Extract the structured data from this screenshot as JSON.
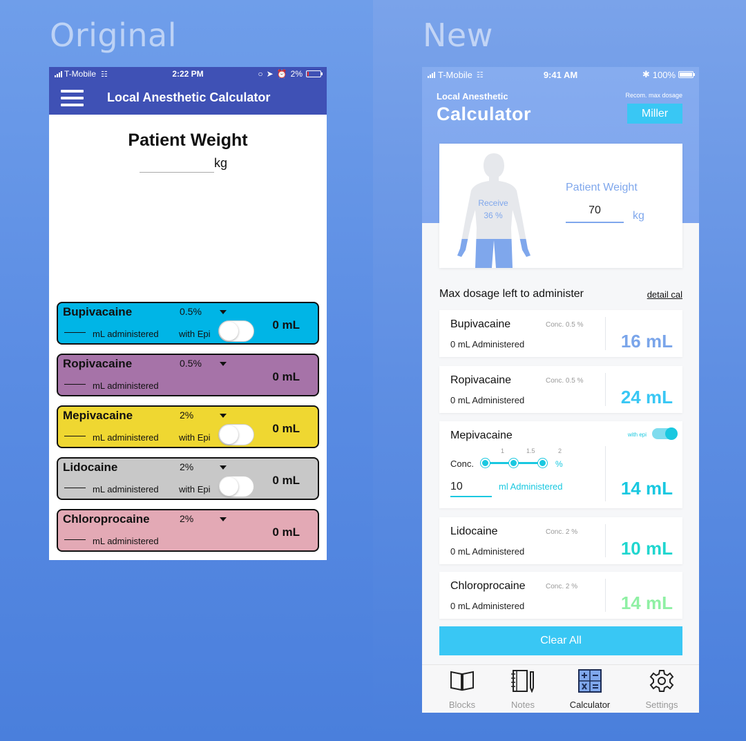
{
  "headings": {
    "original": "Original",
    "new": "New"
  },
  "original": {
    "status": {
      "carrier": "T-Mobile",
      "time": "2:22 PM",
      "battery": "2%"
    },
    "appbar": {
      "title": "Local Anesthetic Calculator"
    },
    "weight": {
      "title": "Patient Weight",
      "unit": "kg"
    },
    "drugs": [
      {
        "name": "Bupivacaine",
        "conc": "0.5%",
        "admin": "mL administered",
        "epi": "with Epi",
        "has_epi": true,
        "total": "0 mL",
        "color": "#00b5e6"
      },
      {
        "name": "Ropivacaine",
        "conc": "0.5%",
        "admin": "mL administered",
        "epi": "",
        "has_epi": false,
        "total": "0 mL",
        "color": "#a673a8"
      },
      {
        "name": "Mepivacaine",
        "conc": "2%",
        "admin": "mL administered",
        "epi": "with Epi",
        "has_epi": true,
        "total": "0 mL",
        "color": "#efd731"
      },
      {
        "name": "Lidocaine",
        "conc": "2%",
        "admin": "mL administered",
        "epi": "with Epi",
        "has_epi": true,
        "total": "0 mL",
        "color": "#c8c8c8"
      },
      {
        "name": "Chloroprocaine",
        "conc": "2%",
        "admin": "mL administered",
        "epi": "",
        "has_epi": false,
        "total": "0 mL",
        "color": "#e3a9b5"
      }
    ]
  },
  "new": {
    "status": {
      "carrier": "T-Mobile",
      "time": "9:41 AM",
      "battery": "100%"
    },
    "header": {
      "subtitle": "Local Anesthetic",
      "title": "Calculator",
      "recom_label": "Recom. max dosage",
      "recom_value": "Miller"
    },
    "weight_card": {
      "receive_label": "Receive",
      "receive_pct": "36 %",
      "label": "Patient Weight",
      "value": "70",
      "unit": "kg"
    },
    "max_label": "Max dosage left to administer",
    "detail_link": "detail cal",
    "cards": [
      {
        "name": "Bupivacaine",
        "conc": "Conc. 0.5 %",
        "admin": "0 mL Administered",
        "value": "16 mL",
        "color": "#7aa5ea"
      },
      {
        "name": "Ropivacaine",
        "conc": "Conc. 0.5 %",
        "admin": "0 mL Administered",
        "value": "24 mL",
        "color": "#39c7f4"
      },
      {
        "name": "Lidocaine",
        "conc": "Conc. 2 %",
        "admin": "0 mL Administered",
        "value": "10 mL",
        "color": "#20d6cf"
      },
      {
        "name": "Chloroprocaine",
        "conc": "Conc. 2 %",
        "admin": "0 mL Administered",
        "value": "14 mL",
        "color": "#8ff0a4"
      }
    ],
    "mepivacaine": {
      "name": "Mepivacaine",
      "epi_label": "with epi",
      "epi_on": true,
      "conc_label": "Conc.",
      "ticks": [
        "1",
        "1.5",
        "2"
      ],
      "pct": "%",
      "input_value": "10",
      "admin_label": "ml Administered",
      "value": "14 mL",
      "color": "#19c8e0"
    },
    "clear_label": "Clear All",
    "tabs": [
      {
        "label": "Blocks",
        "icon": "book-icon",
        "active": false
      },
      {
        "label": "Notes",
        "icon": "notebook-icon",
        "active": false
      },
      {
        "label": "Calculator",
        "icon": "calculator-icon",
        "active": true
      },
      {
        "label": "Settings",
        "icon": "gear-icon",
        "active": false
      }
    ]
  }
}
